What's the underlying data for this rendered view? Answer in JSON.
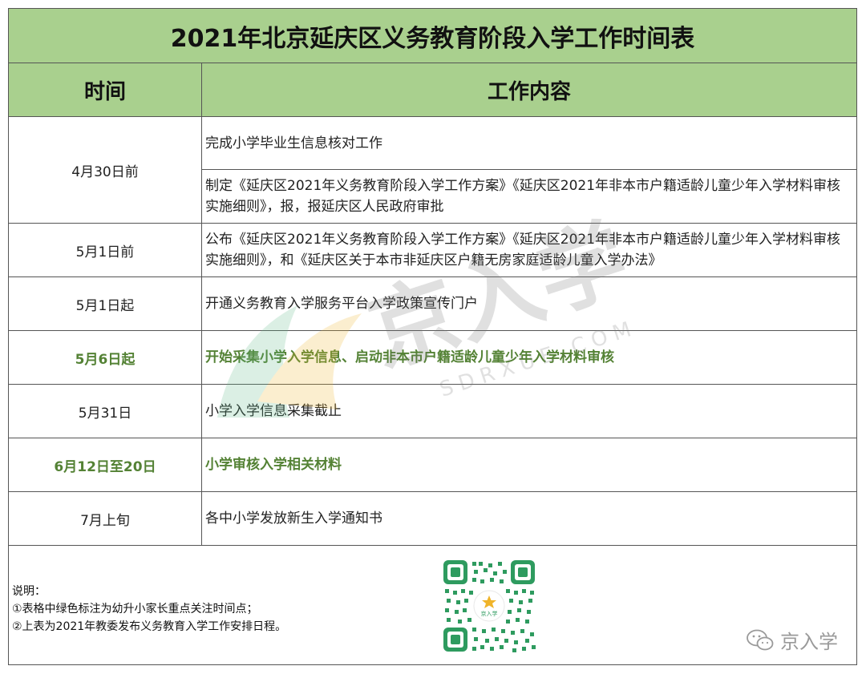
{
  "title": "2021年北京延庆区义务教育阶段入学工作时间表",
  "headers": {
    "time": "时间",
    "content": "工作内容"
  },
  "rows": [
    {
      "time": "4月30日前",
      "items": [
        "完成小学毕业生信息核对工作",
        "制定《延庆区2021年义务教育阶段入学工作方案》《延庆区2021年非本市户籍适龄儿童少年入学材料审核实施细则》，报，报延庆区人民政府审批"
      ]
    },
    {
      "time": "5月1日前",
      "content": "公布《延庆区2021年义务教育阶段入学工作方案》《延庆区2021年非本市户籍适龄儿童少年入学材料审核实施细则》，和《延庆区关于本市非延庆区户籍无房家庭适龄儿童入学办法》"
    },
    {
      "time": "5月1日起",
      "content": "开通义务教育入学服务平台入学政策宣传门户"
    },
    {
      "time": "5月6日起",
      "content": "开始采集小学入学信息、启动非本市户籍适龄儿童少年入学材料审核",
      "highlight": true
    },
    {
      "time": "5月31日",
      "content": "小学入学信息采集截止"
    },
    {
      "time": "6月12日至20日",
      "content": "小学审核入学相关材料",
      "highlight": true
    },
    {
      "time": "7月上旬",
      "content": "各中小学发放新生入学通知书"
    }
  ],
  "notes": {
    "heading": "说明：",
    "line1": "①表格中绿色标注为幼升小家长重点关注时间点；",
    "line2": "②上表为2021年教委发布义务教育入学工作安排日程。"
  },
  "qr_logo_text": "京入学",
  "brand": "京入学",
  "watermark": {
    "main": "京入学",
    "sub": "SDRXUE.COM"
  },
  "colors": {
    "header_bg": "#a9d08e",
    "highlight_text": "#548235",
    "qr_green": "#2e9b5f"
  }
}
